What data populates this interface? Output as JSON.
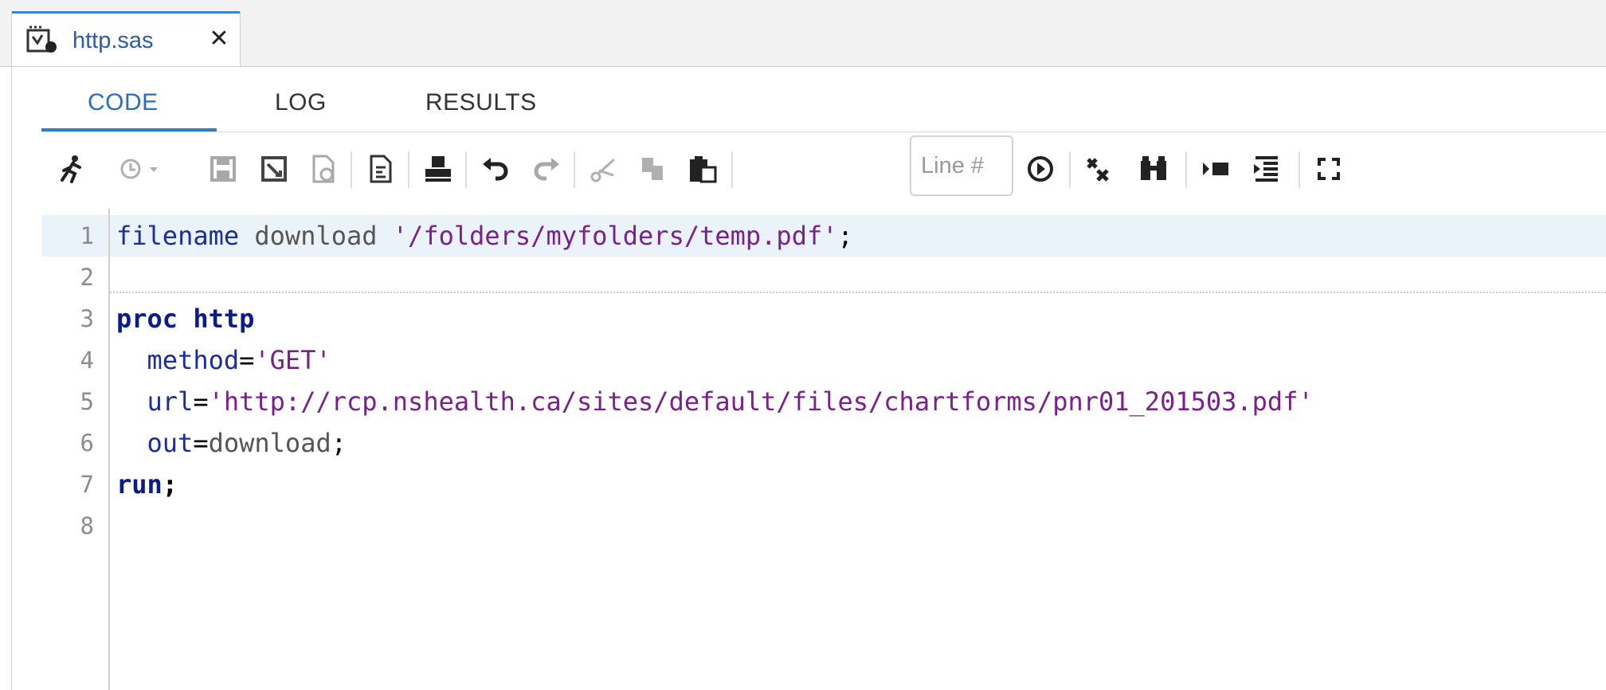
{
  "file_tab": {
    "title": "http.sas",
    "close": "✕"
  },
  "subtabs": {
    "code": "CODE",
    "log": "LOG",
    "results": "RESULTS",
    "active": "CODE"
  },
  "toolbar": {
    "line_placeholder": "Line #"
  },
  "editor": {
    "line_numbers": [
      "1",
      "2",
      "3",
      "4",
      "5",
      "6",
      "7",
      "8"
    ],
    "lines": {
      "l1": {
        "kw": "filename",
        "rest": " download ",
        "str": "'/folders/myfolders/temp.pdf'",
        "end": ";"
      },
      "l3": {
        "text": "proc http"
      },
      "l4": {
        "indent": "  ",
        "kw": "method",
        "eq": "=",
        "str": "'GET'"
      },
      "l5": {
        "indent": "  ",
        "kw": "url",
        "eq": "=",
        "str": "'http://rcp.nshealth.ca/sites/default/files/chartforms/pnr01_201503.pdf'"
      },
      "l6": {
        "indent": "  ",
        "kw": "out",
        "eq": "=",
        "val": "download",
        "end": ";"
      },
      "l7": {
        "kw": "run",
        "end": ";"
      }
    }
  },
  "colors": {
    "accent": "#2f7fc1",
    "keyword": "#1a2d9c",
    "string": "#7a1f8c",
    "active_line": "#eaf3fa"
  },
  "icons": [
    "run-icon",
    "history-icon",
    "save-icon",
    "save-as-icon",
    "save-all-icon",
    "format-code-icon",
    "print-icon",
    "undo-icon",
    "redo-icon",
    "cut-icon",
    "copy-icon",
    "paste-icon",
    "go-to-line-icon",
    "clear-code-icon",
    "find-replace-icon",
    "insert-snippet-icon",
    "indent-icon",
    "maximize-icon"
  ]
}
